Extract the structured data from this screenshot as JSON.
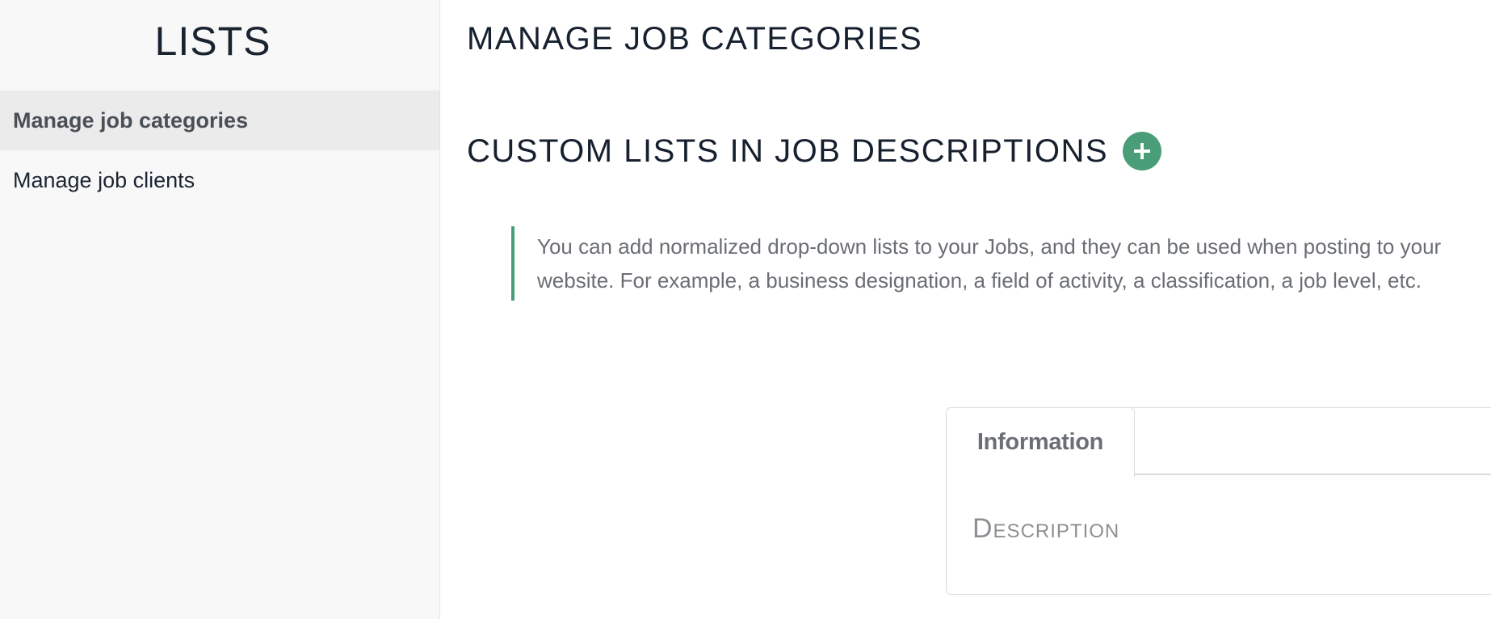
{
  "sidebar": {
    "title": "LISTS",
    "items": [
      {
        "label": "Manage job categories",
        "active": true
      },
      {
        "label": "Manage job clients",
        "active": false
      }
    ]
  },
  "main": {
    "page_title": "MANAGE JOB CATEGORIES",
    "section_title": "CUSTOM LISTS IN JOB DESCRIPTIONS",
    "add_button_icon": "plus-icon",
    "info_text": "You can add normalized drop-down lists to your Jobs, and they can be used when posting to your website. For example, a business designation, a field of activity, a classification, a job level, etc.",
    "panel": {
      "tabs": [
        {
          "label": "Information",
          "active": true
        }
      ],
      "field_label": "Description"
    }
  },
  "colors": {
    "accent": "#4a9e77",
    "heading": "#16202e",
    "sidebar_bg": "#f8f8f8",
    "active_item_bg": "#ebebeb"
  }
}
